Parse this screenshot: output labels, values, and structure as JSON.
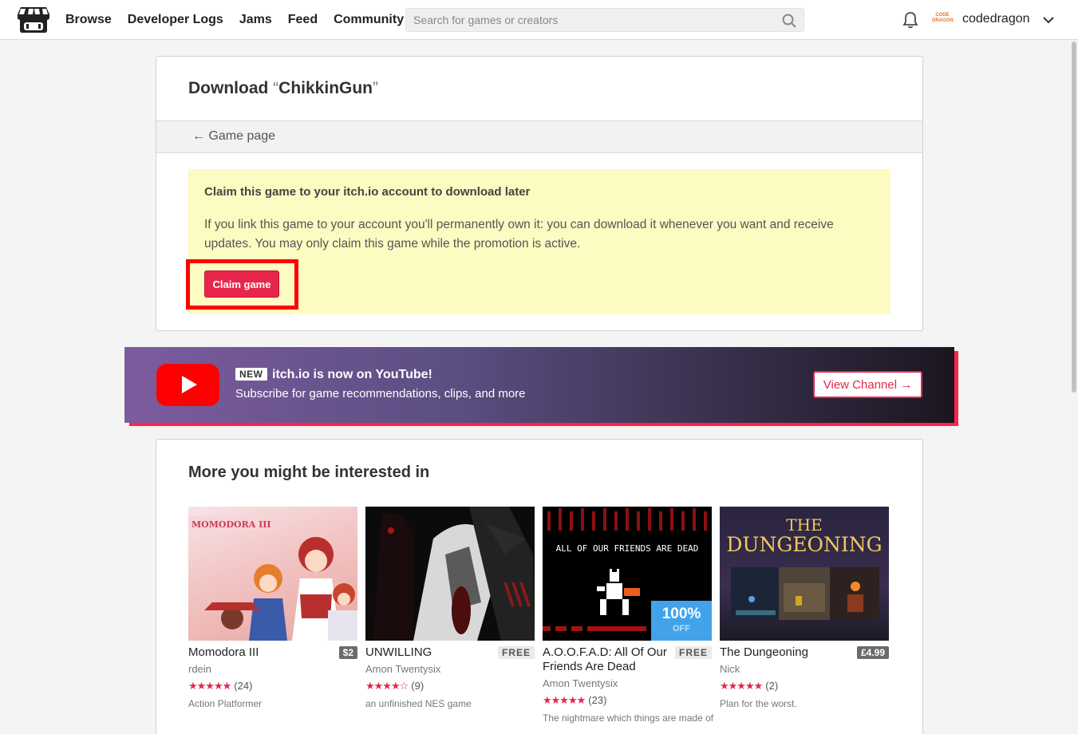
{
  "header": {
    "nav": [
      "Browse",
      "Developer Logs",
      "Jams",
      "Feed",
      "Community"
    ],
    "search_placeholder": "Search for games or creators",
    "avatar_text": "CODE DRAGON",
    "username": "codedragon"
  },
  "download": {
    "title_prefix": "Download",
    "open_quote": "“",
    "game_name": "ChikkinGun",
    "close_quote": "”",
    "back_link": "← Game page",
    "claim_title": "Claim this game to your itch.io account to download later",
    "claim_text": "If you link this game to your account you'll permanently own it: you can download it whenever you want and receive updates. You may only claim this game while the promotion is active.",
    "claim_button": "Claim game"
  },
  "youtube": {
    "badge": "NEW",
    "headline": "itch.io is now on YouTube!",
    "subtitle": "Subscribe for game recommendations, clips, and more",
    "button": "View Channel →"
  },
  "more": {
    "title": "More you might be interested in",
    "games": [
      {
        "title": "Momodora III",
        "price": "$2",
        "author": "rdein",
        "stars": "★★★★★",
        "count": "(24)",
        "desc": "Action Platformer",
        "thumb_text": "MOMODORA III"
      },
      {
        "title": "UNWILLING",
        "price": "FREE",
        "author": "Amon Twentysix",
        "stars": "★★★★☆",
        "count": "(9)",
        "desc": "an unfinished NES game"
      },
      {
        "title": "A.O.O.F.A.D: All Of Our Friends Are Dead",
        "price": "FREE",
        "author": "Amon Twentysix",
        "stars": "★★★★★",
        "count": "(23)",
        "desc": "The nightmare which things are made of",
        "thumb_text": "ALL OF OUR FRIENDS ARE DEAD",
        "discount": "100%",
        "discount_off": "OFF"
      },
      {
        "title": "The Dungeoning",
        "price": "£4.99",
        "author": "Nick",
        "stars": "★★★★★",
        "count": "(2)",
        "desc": "Plan for the worst.",
        "thumb_text_1": "THE",
        "thumb_text_2": "DUNGEONING"
      }
    ]
  },
  "colors": {
    "accent": "#e8264c",
    "claim_bg": "#fcfbc1",
    "youtube_red": "#ff0000",
    "discount_blue": "#42a3eb"
  }
}
